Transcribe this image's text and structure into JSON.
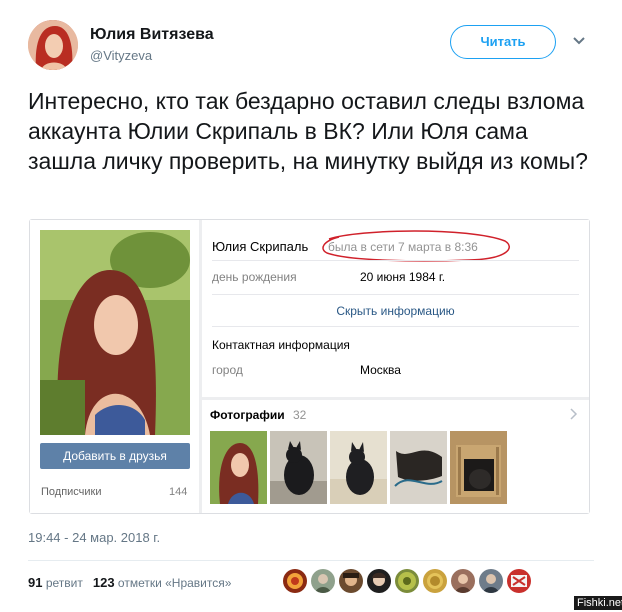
{
  "author": {
    "name": "Юлия Витязева",
    "handle": "@Vityzeva",
    "follow_label": "Читать"
  },
  "tweet": {
    "text": "Интересно, кто так бездарно оставил следы взлома аккаунта Юлии Скрипаль в ВК? Или Юля сама зашла личку проверить, на минутку выйдя из комы?",
    "timestamp": "19:44 - 24 мар. 2018 г.",
    "retweets_count": "91",
    "retweets_label": "ретвит",
    "likes_count": "123",
    "likes_label": "отметки «Нравится»"
  },
  "vk_profile": {
    "name": "Юлия Скрипаль",
    "online_status": "была в сети 7 марта в 8:36",
    "birthday_label": "день рождения",
    "birthday_value": "20 июня 1984 г.",
    "show_more_label": "Скрыть информацию",
    "contact_title": "Контактная информация",
    "city_label": "город",
    "city_value": "Москва",
    "add_friend_label": "Добавить в друзья",
    "subscribers_label": "Подписчики",
    "subscribers_count": "144",
    "photos_title": "Фотографии",
    "photos_count": "32"
  },
  "watermark": "Fishki.net",
  "colors": {
    "twitter_blue": "#1da1f2",
    "vk_blue": "#5e81a8",
    "vk_link": "#2a5885",
    "annotation_red": "#d0212b"
  }
}
